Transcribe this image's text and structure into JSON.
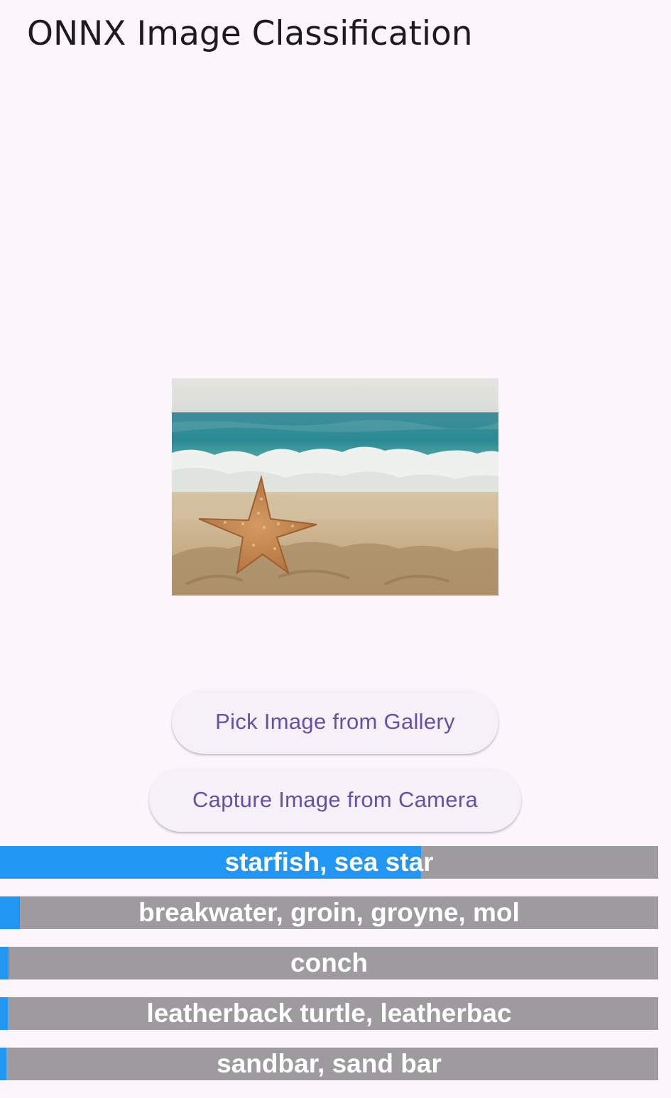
{
  "app": {
    "title": "ONNX Image Classification"
  },
  "image": {
    "icon": "starfish-beach-photo"
  },
  "buttons": {
    "gallery_label": "Pick Image from Gallery",
    "camera_label": "Capture Image from Camera"
  },
  "colors": {
    "background": "#fcf5fc",
    "accent": "#6750a4",
    "bar_fill": "#2196f3",
    "bar_track": "#9e9b9f"
  },
  "predictions": [
    {
      "label": "starfish, sea star",
      "confidence": 0.64
    },
    {
      "label": "breakwater, groin, groyne, mol",
      "confidence": 0.03
    },
    {
      "label": "conch",
      "confidence": 0.013
    },
    {
      "label": "leatherback turtle, leatherbac",
      "confidence": 0.012
    },
    {
      "label": "sandbar, sand bar",
      "confidence": 0.01
    }
  ]
}
